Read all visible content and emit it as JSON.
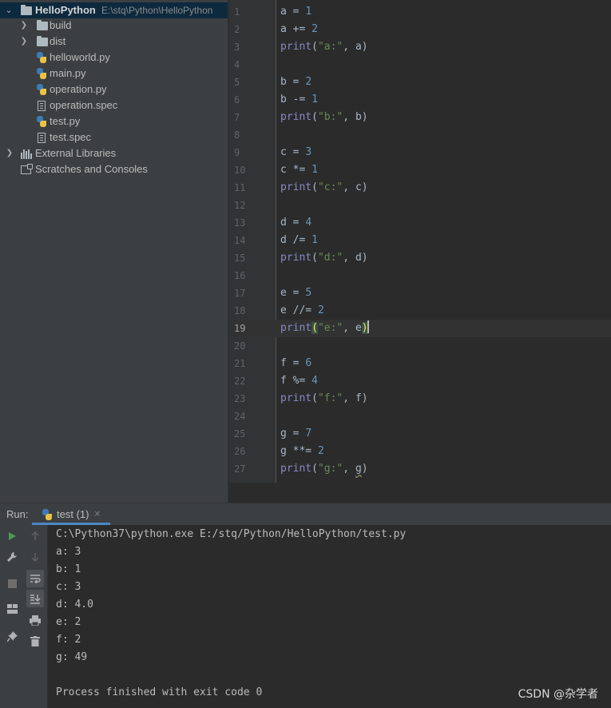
{
  "project": {
    "root_name": "HelloPython",
    "root_path": "E:\\stq\\Python\\HelloPython",
    "items": [
      {
        "label": "build",
        "type": "folder"
      },
      {
        "label": "dist",
        "type": "folder"
      },
      {
        "label": "helloworld.py",
        "type": "python"
      },
      {
        "label": "main.py",
        "type": "python"
      },
      {
        "label": "operation.py",
        "type": "python"
      },
      {
        "label": "operation.spec",
        "type": "spec"
      },
      {
        "label": "test.py",
        "type": "python"
      },
      {
        "label": "test.spec",
        "type": "spec"
      }
    ],
    "external_libraries": "External Libraries",
    "scratches": "Scratches and Consoles"
  },
  "editor": {
    "current_line": 19,
    "line_numbers": [
      "1",
      "2",
      "3",
      "4",
      "5",
      "6",
      "7",
      "8",
      "9",
      "10",
      "11",
      "12",
      "13",
      "14",
      "15",
      "16",
      "17",
      "18",
      "19",
      "20",
      "21",
      "22",
      "23",
      "24",
      "25",
      "26",
      "27"
    ],
    "lines": [
      "a = 1",
      "a += 2",
      "print(\"a:\", a)",
      "",
      "b = 2",
      "b -= 1",
      "print(\"b:\", b)",
      "",
      "c = 3",
      "c *= 1",
      "print(\"c:\", c)",
      "",
      "d = 4",
      "d /= 1",
      "print(\"d:\", d)",
      "",
      "e = 5",
      "e //= 2",
      "print(\"e:\", e)",
      "",
      "f = 6",
      "f %= 4",
      "print(\"f:\", f)",
      "",
      "g = 7",
      "g **= 2",
      "print(\"g:\", g)"
    ]
  },
  "run": {
    "label": "Run:",
    "tab_label": "test (1)",
    "tab_close": "×",
    "output": [
      "C:\\Python37\\python.exe E:/stq/Python/HelloPython/test.py",
      "a: 3",
      "b: 1",
      "c: 3",
      "d: 4.0",
      "e: 2",
      "f: 2",
      "g: 49",
      "",
      "Process finished with exit code 0"
    ]
  },
  "watermark": "CSDN @杂学者",
  "colors": {
    "keyword_builtin": "#8888c6",
    "string": "#6a8759",
    "number": "#6897bb",
    "identifier": "#a9b7c6",
    "selection_row": "#0d293e"
  }
}
